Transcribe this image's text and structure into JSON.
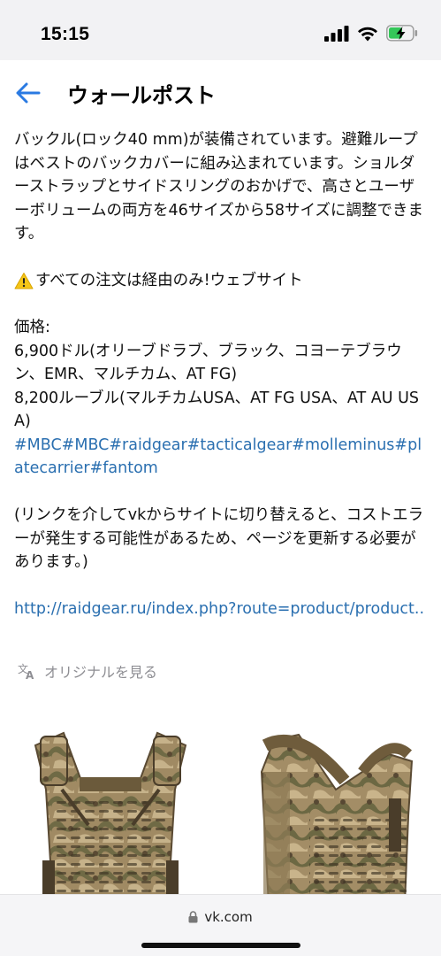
{
  "status": {
    "time": "15:15"
  },
  "header": {
    "title": "ウォールポスト"
  },
  "post": {
    "paragraph1": "バックル(ロック40 mm)が装備されています。避難ループはベストのバックカバーに組み込まれています。ショルダーストラップとサイドスリングのおかげで、高さとユーザーボリュームの両方を46サイズから58サイズに調整できます。",
    "warning": "すべての注文は経由のみ!ウェブサイト",
    "price_label": "価格:",
    "price1": "6,900ドル(オリーブドラブ、ブラック、コヨーテブラウン、EMR、マルチカム、AT FG)",
    "price2": "8,200ルーブル(マルチカムUSA、AT FG USA、AT AU USA)",
    "hashtags": "#MBC#MBC#raidgear#tacticalgear#molleminus#platecarrier#fantom",
    "note": "(リンクを介してvkからサイトに切り替えると、コストエラーが発生する可能性があるため、ページを更新する必要があります。)",
    "link": "http://raidgear.ru/index.php?route=product/product.."
  },
  "translate": {
    "label": "オリジナルを見る",
    "icon": "translate-icon"
  },
  "images": [
    {
      "name": "vest-front-photo"
    },
    {
      "name": "vest-angle-photo"
    }
  ],
  "browser": {
    "url": "vk.com"
  },
  "colors": {
    "link": "#2a6fb0",
    "muted": "#8e8e93",
    "battery_charge": "#34c759"
  }
}
